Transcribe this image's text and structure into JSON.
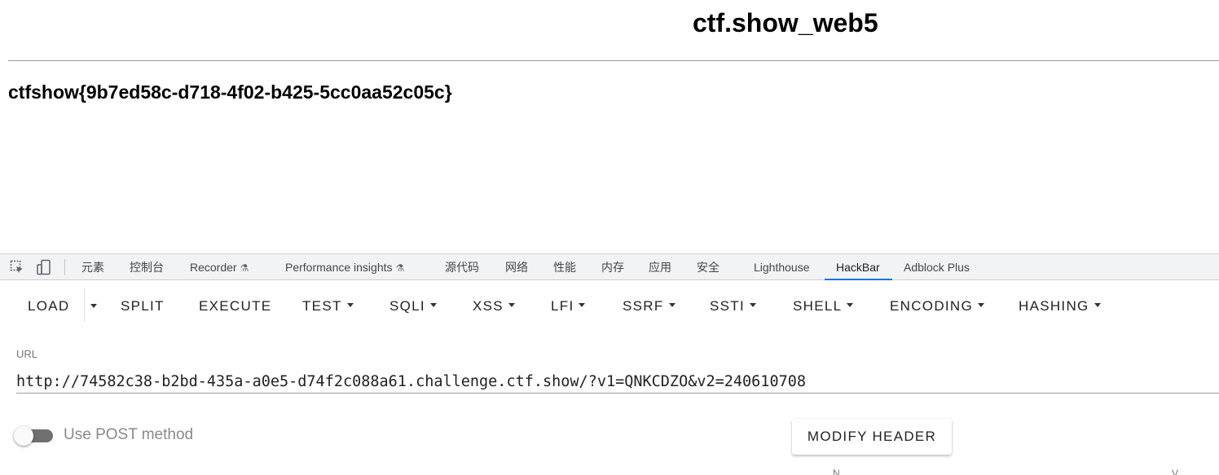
{
  "site": {
    "title": "ctf.show_web5",
    "flag": "ctfshow{9b7ed58c-d718-4f02-b425-5cc0aa52c05c}"
  },
  "devtools": {
    "icons": [
      "inspect-element-icon",
      "device-toolbar-icon"
    ],
    "tabs": [
      {
        "label": "元素"
      },
      {
        "label": "控制台"
      },
      {
        "label": "Recorder"
      },
      {
        "label": "Performance insights"
      },
      {
        "label": "源代码"
      },
      {
        "label": "网络"
      },
      {
        "label": "性能"
      },
      {
        "label": "内存"
      },
      {
        "label": "应用"
      },
      {
        "label": "安全"
      },
      {
        "label": "Lighthouse"
      },
      {
        "label": "HackBar"
      },
      {
        "label": "Adblock Plus"
      }
    ],
    "active_tab": "HackBar",
    "accent_color": "#1a73e8"
  },
  "hackbar": {
    "buttons": [
      {
        "label": "LOAD"
      },
      {
        "label": "SPLIT"
      },
      {
        "label": "EXECUTE"
      },
      {
        "label": "TEST"
      },
      {
        "label": "SQLI"
      },
      {
        "label": "XSS"
      },
      {
        "label": "LFI"
      },
      {
        "label": "SSRF"
      },
      {
        "label": "SSTI"
      },
      {
        "label": "SHELL"
      },
      {
        "label": "ENCODING"
      },
      {
        "label": "HASHING"
      }
    ],
    "url_label": "URL",
    "url_value": "http://74582c38-b2bd-435a-a0e5-d74f2c088a61.challenge.ctf.show/?v1=QNKCDZO&v2=240610708",
    "post_label": "Use POST method",
    "post_enabled": false,
    "modify_header_label": "MODIFY HEADER",
    "column_fragments": [
      "N",
      "V"
    ]
  }
}
